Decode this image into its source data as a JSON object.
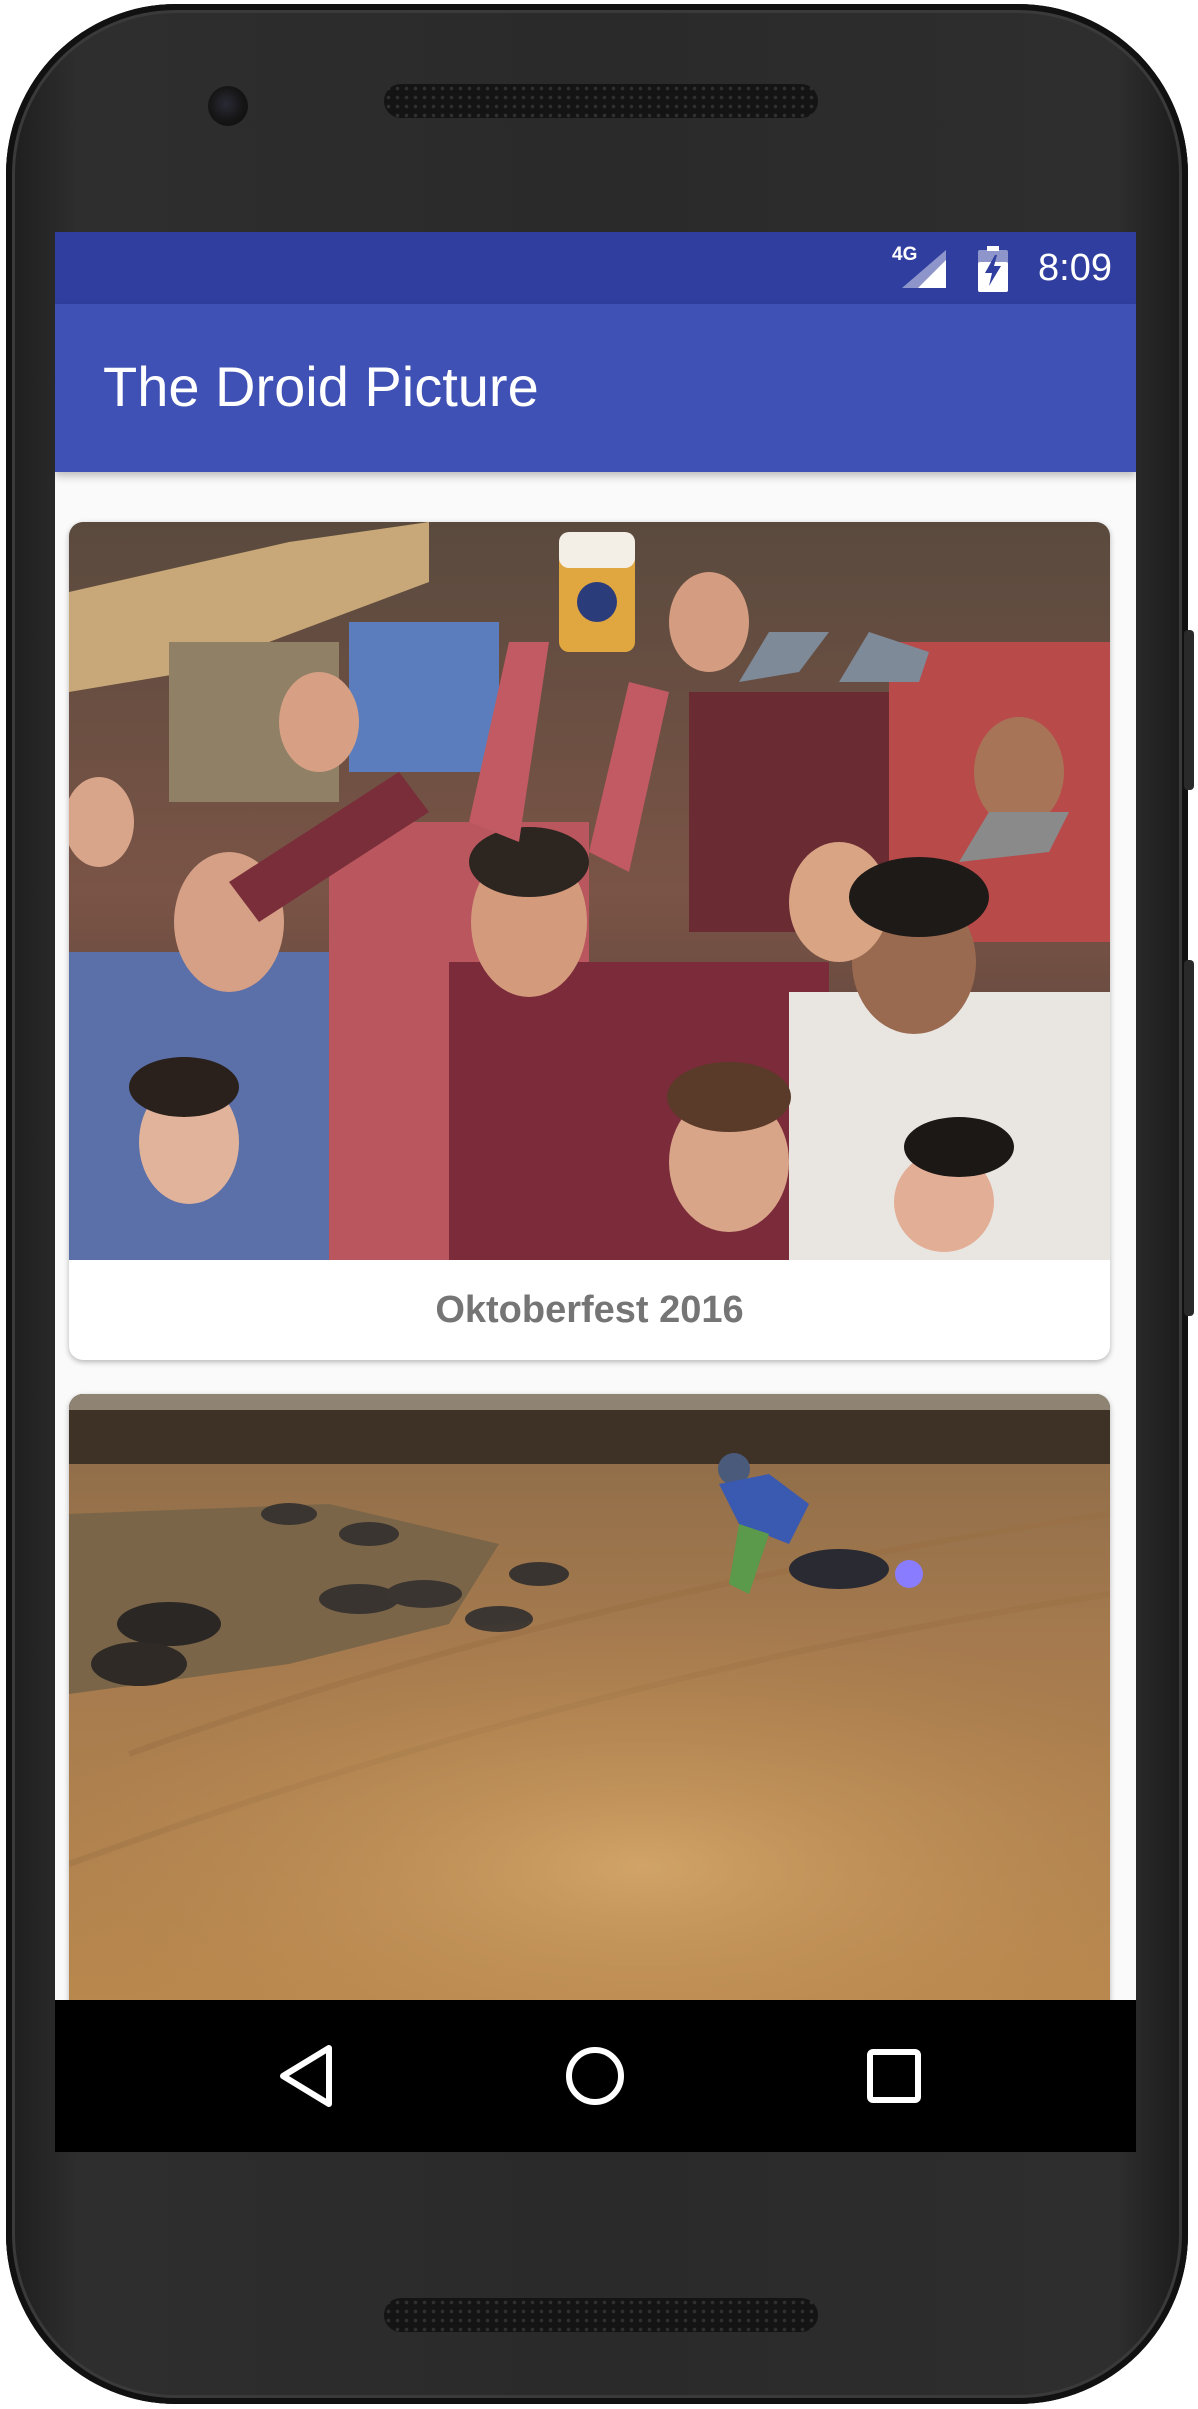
{
  "status_bar": {
    "network": "4G",
    "time": "8:09",
    "color": "#303f9f"
  },
  "app_bar": {
    "title": "The Droid Picture",
    "color": "#3f51b5"
  },
  "feed": {
    "cards": [
      {
        "caption": "Oktoberfest 2016",
        "image": "crowd-celebration-photo"
      },
      {
        "caption": "",
        "image": "motorcycle-dirt-track-photo"
      }
    ]
  },
  "nav_bar": {
    "buttons": [
      "back-icon",
      "home-icon",
      "recents-icon"
    ]
  }
}
